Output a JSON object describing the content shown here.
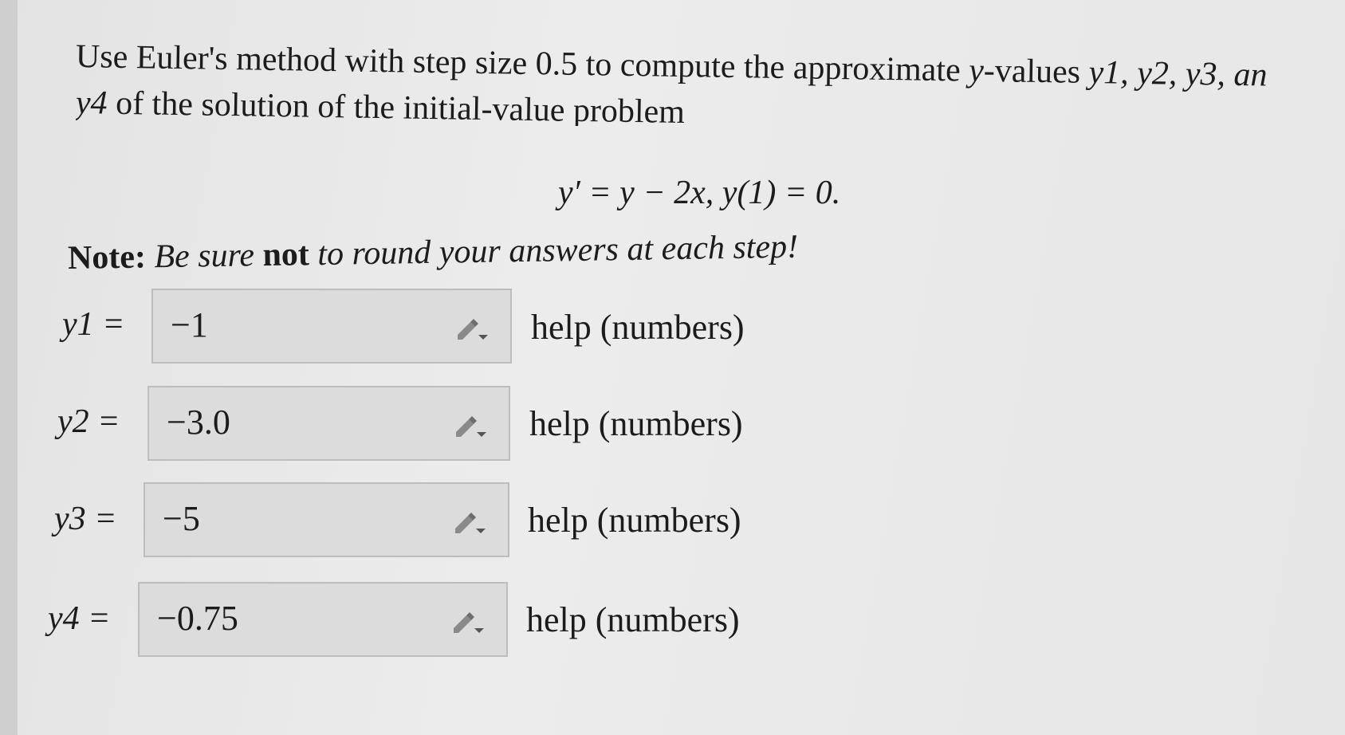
{
  "problem": {
    "line1_prefix": "Use Euler's method with step size 0.5 to compute the approximate ",
    "line1_yvar": "y",
    "line1_mid": "-values ",
    "line1_vars": "y1, y2, y3, an",
    "line2_var": "y4",
    "line2_text": " of the solution of the initial-value problem"
  },
  "equation": "y′ = y − 2x,     y(1) = 0.",
  "note": {
    "label": "Note:",
    "text1": " Be sure ",
    "emph": "not",
    "text2": " to round your answers at each step!"
  },
  "answers": [
    {
      "label": "y1 =",
      "value": "−1",
      "help": "help (numbers)"
    },
    {
      "label": "y2 =",
      "value": "−3.0",
      "help": "help (numbers)"
    },
    {
      "label": "y3 =",
      "value": "−5",
      "help": "help (numbers)"
    },
    {
      "label": "y4 =",
      "value": "−0.75",
      "help": "help (numbers)"
    }
  ],
  "icons": {
    "edit": "pencil-dropdown-icon"
  }
}
